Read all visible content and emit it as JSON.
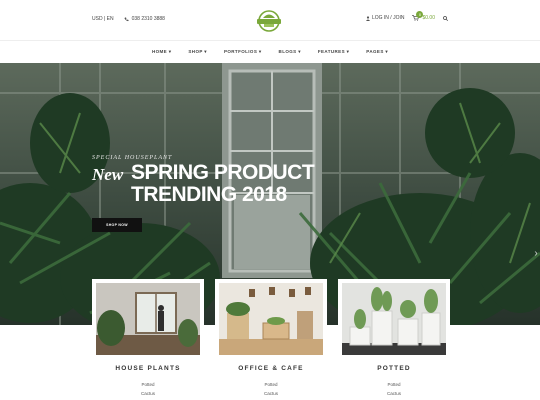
{
  "topbar": {
    "currency": "USD | EN",
    "phone": "038 2310 3888",
    "account": "LOG IN / JOIN",
    "cart_count": "0",
    "cart_total": "$0.00"
  },
  "nav": {
    "items": [
      "HOME ▾",
      "SHOP ▾",
      "PORTFOLIOS ▾",
      "BLOGS ▾",
      "FEATURES ▾",
      "PAGES ▾"
    ]
  },
  "hero": {
    "kicker": "SPECIAL HOUSEPLANT",
    "new_word": "New",
    "headline_1": "SPRING PRODUCT",
    "headline_2": "TRENDING 2018",
    "button": "SHOP NOW"
  },
  "categories": [
    {
      "title": "HOUSE PLANTS",
      "links": [
        "Potted",
        "Cactus"
      ]
    },
    {
      "title": "OFFICE & CAFE",
      "links": [
        "Potted",
        "Cactus"
      ]
    },
    {
      "title": "POTTED",
      "links": [
        "Potted",
        "Cactus"
      ]
    }
  ],
  "colors": {
    "accent": "#7aa83a",
    "button": "#111111"
  }
}
